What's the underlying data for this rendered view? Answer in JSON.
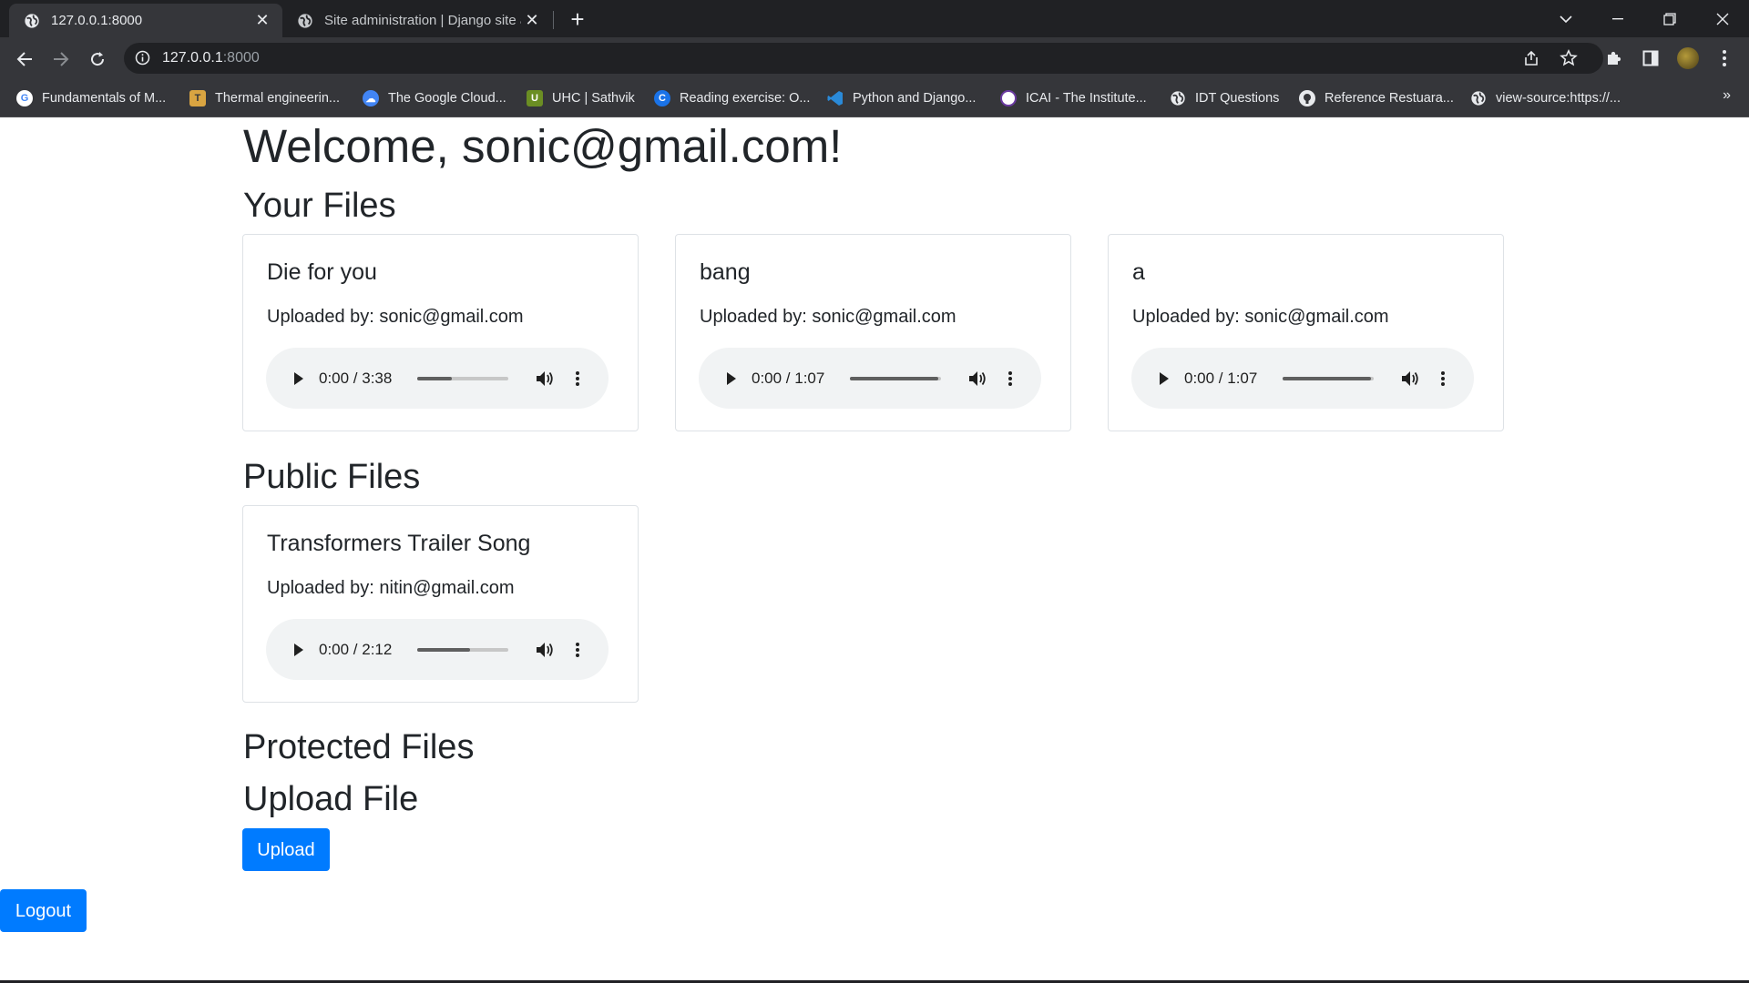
{
  "browser": {
    "tabs": [
      {
        "title": "127.0.0.1:8000",
        "active": true
      },
      {
        "title": "Site administration | Django site admin",
        "active": false
      }
    ],
    "url_host": "127.0.0.1",
    "url_port": ":8000",
    "bookmarks": [
      {
        "label": "Fundamentals of M...",
        "icon": "google-icon"
      },
      {
        "label": "Thermal engineerin...",
        "icon": "bookmark-icon"
      },
      {
        "label": "The Google Cloud...",
        "icon": "cloud-icon"
      },
      {
        "label": "UHC | Sathvik",
        "icon": "bookmark-icon"
      },
      {
        "label": "Reading exercise: O...",
        "icon": "c-icon"
      },
      {
        "label": "Python and Django...",
        "icon": "vscode-icon"
      },
      {
        "label": "ICAI - The Institute...",
        "icon": "icai-icon"
      },
      {
        "label": "IDT Questions",
        "icon": "globe-icon"
      },
      {
        "label": "Reference Restuara...",
        "icon": "github-icon"
      },
      {
        "label": "view-source:https://...",
        "icon": "globe-icon"
      }
    ],
    "bookmarks_more": "»"
  },
  "page": {
    "welcome": "Welcome, sonic@gmail.com!",
    "your_files_heading": "Your Files",
    "public_files_heading": "Public Files",
    "protected_files_heading": "Protected Files",
    "upload_heading": "Upload File",
    "upload_button": "Upload",
    "logout_button": "Logout",
    "your_files": [
      {
        "title": "Die for you",
        "uploaded_by": "Uploaded by: sonic@gmail.com",
        "time": "0:00 / 3:38",
        "buffered": 0.38
      },
      {
        "title": "bang",
        "uploaded_by": "Uploaded by: sonic@gmail.com",
        "time": "0:00 / 1:07",
        "buffered": 0.97
      },
      {
        "title": "a",
        "uploaded_by": "Uploaded by: sonic@gmail.com",
        "time": "0:00 / 1:07",
        "buffered": 0.97
      }
    ],
    "public_files": [
      {
        "title": "Transformers Trailer Song",
        "uploaded_by": "Uploaded by: nitin@gmail.com",
        "time": "0:00 / 2:12",
        "buffered": 0.58
      }
    ]
  },
  "colors": {
    "primary": "#007bff",
    "chrome_dark": "#202124",
    "chrome_toolbar": "#35363a",
    "player_bg": "#f1f3f4"
  }
}
